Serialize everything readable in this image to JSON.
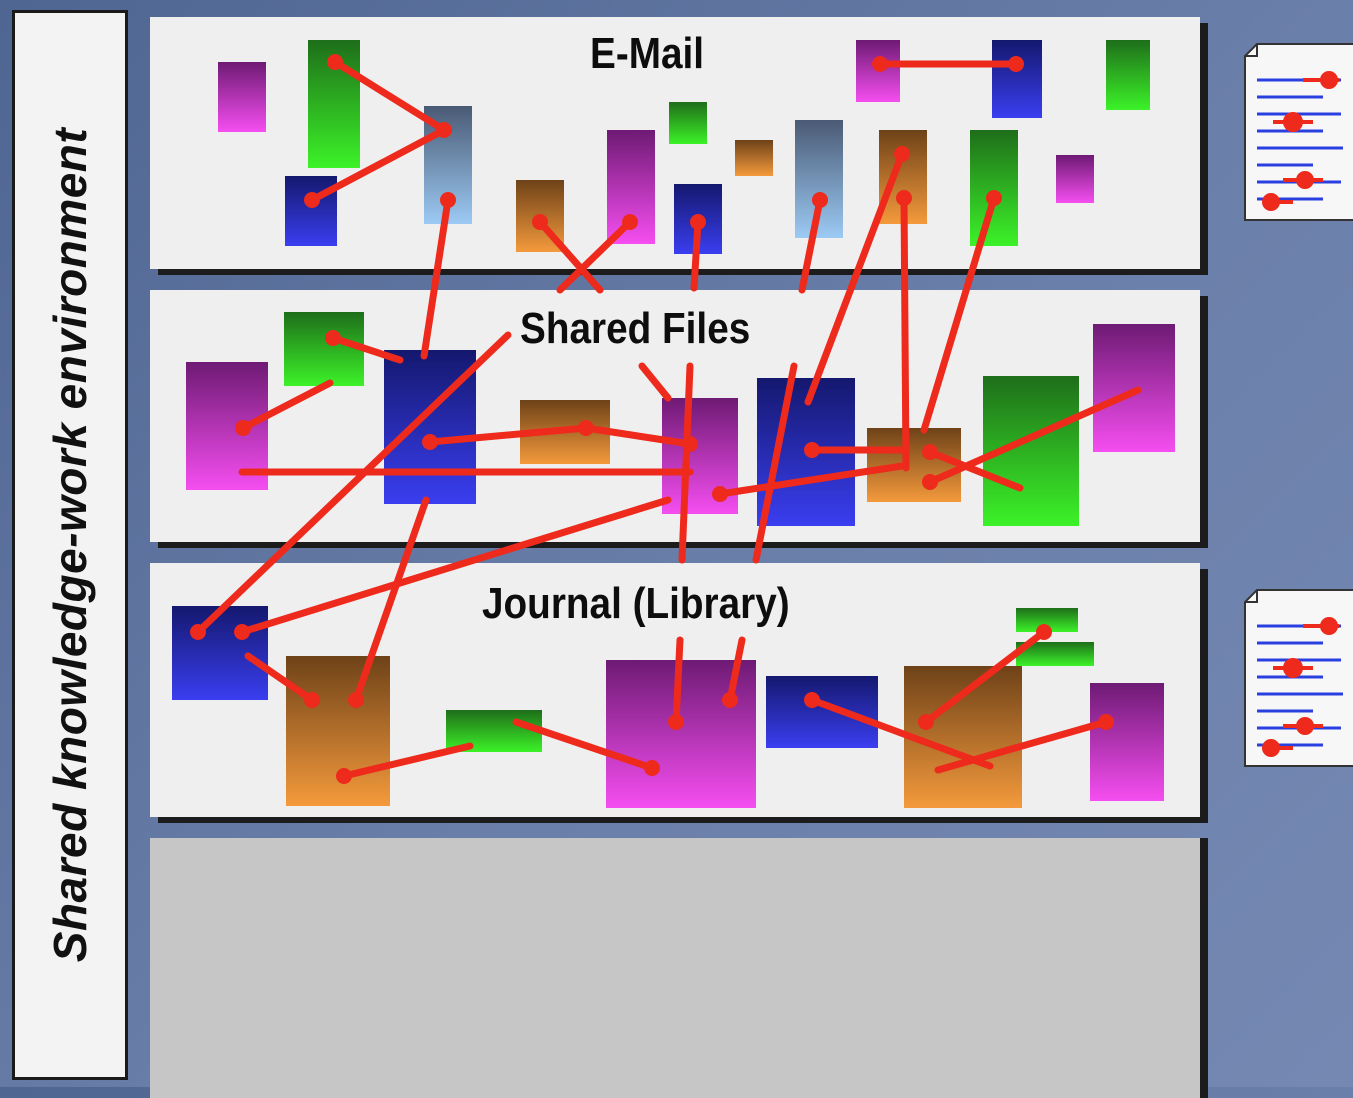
{
  "side_label": "Shared knowledge-work environment",
  "layers": {
    "email": "E-Mail",
    "shared_files": "Shared Files",
    "journal": "Journal (Library)"
  },
  "colors": {
    "link": "#ee2a1c",
    "doc_line": "#2a3fe0",
    "doc_dot": "#ee2a1c",
    "purple_magenta": [
      "#6e1a74",
      "#f54ef0"
    ],
    "green": [
      "#1e6e1a",
      "#3cf228"
    ],
    "blue": [
      "#14186e",
      "#3a3ef0"
    ],
    "steel": [
      "#4a5a74",
      "#9ccaf4"
    ],
    "brown_orange": [
      "#6e4218",
      "#f49a3c"
    ]
  },
  "icons": [
    "document-icon",
    "document-icon"
  ]
}
